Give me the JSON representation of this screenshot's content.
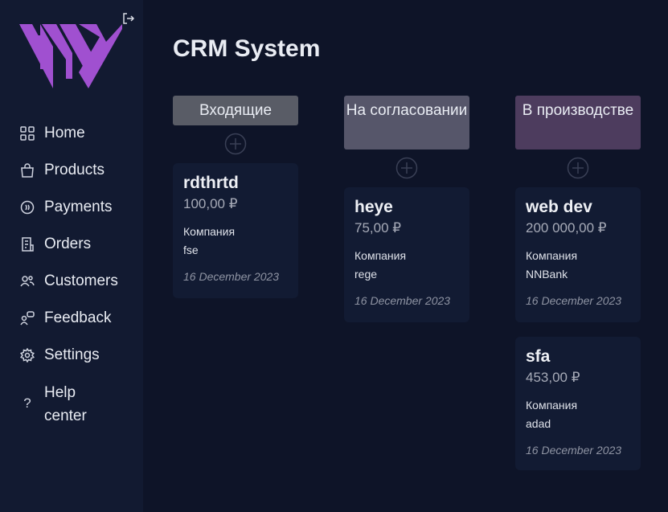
{
  "app": {
    "title": "CRM System"
  },
  "colors": {
    "brand_purple": "#a050d0",
    "sidebar_bg": "#121a31",
    "page_bg": "#0e1428",
    "card_bg": "#121b33",
    "col_incoming": "#595c66",
    "col_approval": "#56566a",
    "col_production": "#4d3c5e"
  },
  "sidebar": {
    "logout_icon": "logout-icon",
    "items": [
      {
        "label": "Home",
        "icon": "grid-icon"
      },
      {
        "label": "Products",
        "icon": "bag-icon"
      },
      {
        "label": "Payments",
        "icon": "coin-icon"
      },
      {
        "label": "Orders",
        "icon": "receipt-icon"
      },
      {
        "label": "Customers",
        "icon": "users-icon"
      },
      {
        "label": "Feedback",
        "icon": "chat-user-icon"
      },
      {
        "label": "Settings",
        "icon": "gear-icon"
      },
      {
        "label": "Help center",
        "icon": "question-icon",
        "icon_glyph": "?"
      }
    ]
  },
  "board": {
    "columns": [
      {
        "title": "Входящие",
        "cards": [
          {
            "title": "rdthrtd",
            "price": "100,00 ₽",
            "company_label": "Компания",
            "company": "fse",
            "date": "16 December 2023"
          }
        ]
      },
      {
        "title": "На согласовании",
        "cards": [
          {
            "title": "heye",
            "price": "75,00 ₽",
            "company_label": "Компания",
            "company": "rege",
            "date": "16 December 2023"
          }
        ]
      },
      {
        "title": "В производстве",
        "cards": [
          {
            "title": "web dev",
            "price": "200 000,00 ₽",
            "company_label": "Компания",
            "company": "NNBank",
            "date": "16 December 2023"
          },
          {
            "title": "sfa",
            "price": "453,00 ₽",
            "company_label": "Компания",
            "company": "adad",
            "date": "16 December 2023"
          }
        ]
      }
    ]
  }
}
